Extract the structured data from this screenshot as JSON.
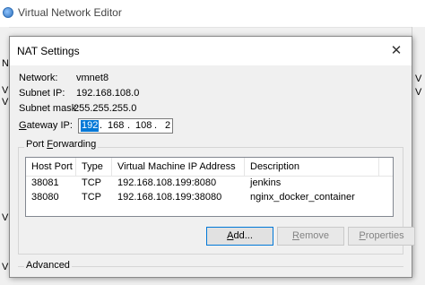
{
  "parent": {
    "title": "Virtual Network Editor",
    "left_fragments": [
      "N",
      "V",
      "V",
      "V",
      "V"
    ],
    "right_fragments": [
      "V",
      "V"
    ]
  },
  "dialog": {
    "title": "NAT Settings",
    "close_glyph": "✕",
    "fields": {
      "network_label": "Network:",
      "network_value": "vmnet8",
      "subnet_ip_label": "Subnet IP:",
      "subnet_ip_value": "192.168.108.0",
      "subnet_mask_label": "Subnet mask:",
      "subnet_mask_value": "255.255.255.0",
      "gateway_label_accel": "G",
      "gateway_label_rest": "ateway IP:",
      "gateway_octets": [
        "192",
        "168",
        "108",
        "2"
      ],
      "gateway_dot": "."
    },
    "port_forwarding": {
      "title_pre": "Port ",
      "title_accel": "F",
      "title_post": "orwarding",
      "columns": [
        "Host Port",
        "Type",
        "Virtual Machine IP Address",
        "Description"
      ],
      "rows": [
        [
          "38081",
          "TCP",
          "192.168.108.199:8080",
          "jenkins"
        ],
        [
          "38080",
          "TCP",
          "192.168.108.199:38080",
          "nginx_docker_container"
        ]
      ],
      "buttons": {
        "add_accel": "A",
        "add_rest": "dd...",
        "remove_accel": "R",
        "remove_rest": "emove",
        "properties_accel": "P",
        "properties_rest": "roperties"
      }
    },
    "advanced_title": "Advanced"
  }
}
